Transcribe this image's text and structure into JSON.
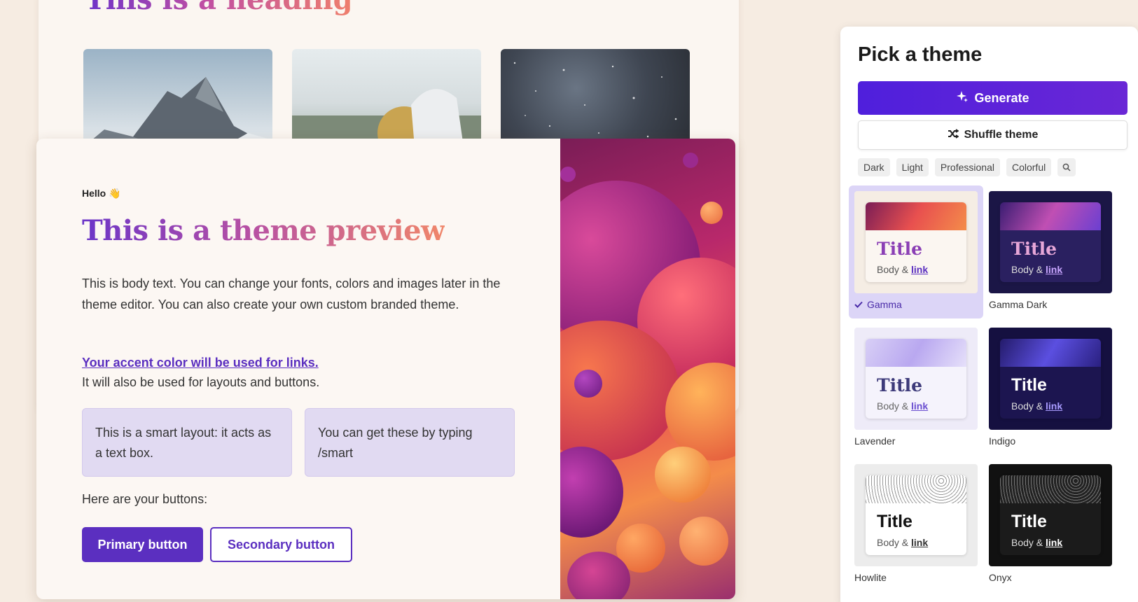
{
  "back_card": {
    "heading": "This is a heading"
  },
  "preview": {
    "greeting": "Hello 👋",
    "title": "This is a theme preview",
    "body": "This is body text. You can change your fonts, colors and images later in the theme editor. You can also create your own custom branded theme.",
    "accent_link": "Your accent color will be used for links.",
    "accent_note": "It will also be used for layouts and buttons.",
    "smart_box_1": "This is a smart layout: it acts as a text box.",
    "smart_box_2": "You can get these by typing /smart",
    "buttons_label": "Here are your buttons:",
    "primary_button": "Primary button",
    "secondary_button": "Secondary button"
  },
  "theme_panel": {
    "title": "Pick a theme",
    "generate_label": "Generate",
    "shuffle_label": "Shuffle theme",
    "filters": [
      "Dark",
      "Light",
      "Professional",
      "Colorful"
    ],
    "themes": [
      {
        "name": "Gamma",
        "title": "Title",
        "body": "Body &",
        "link": "link",
        "selected": true
      },
      {
        "name": "Gamma Dark",
        "title": "Title",
        "body": "Body &",
        "link": "link",
        "selected": false
      },
      {
        "name": "Lavender",
        "title": "Title",
        "body": "Body &",
        "link": "link",
        "selected": false
      },
      {
        "name": "Indigo",
        "title": "Title",
        "body": "Body &",
        "link": "link",
        "selected": false
      },
      {
        "name": "Howlite",
        "title": "Title",
        "body": "Body &",
        "link": "link",
        "selected": false
      },
      {
        "name": "Onyx",
        "title": "Title",
        "body": "Body &",
        "link": "link",
        "selected": false
      }
    ]
  },
  "colors": {
    "accent": "#5b2fc0",
    "generate_button": "#4f1fdc",
    "smart_layout_bg": "#e1daf2",
    "page_background": "#f6ece2"
  }
}
